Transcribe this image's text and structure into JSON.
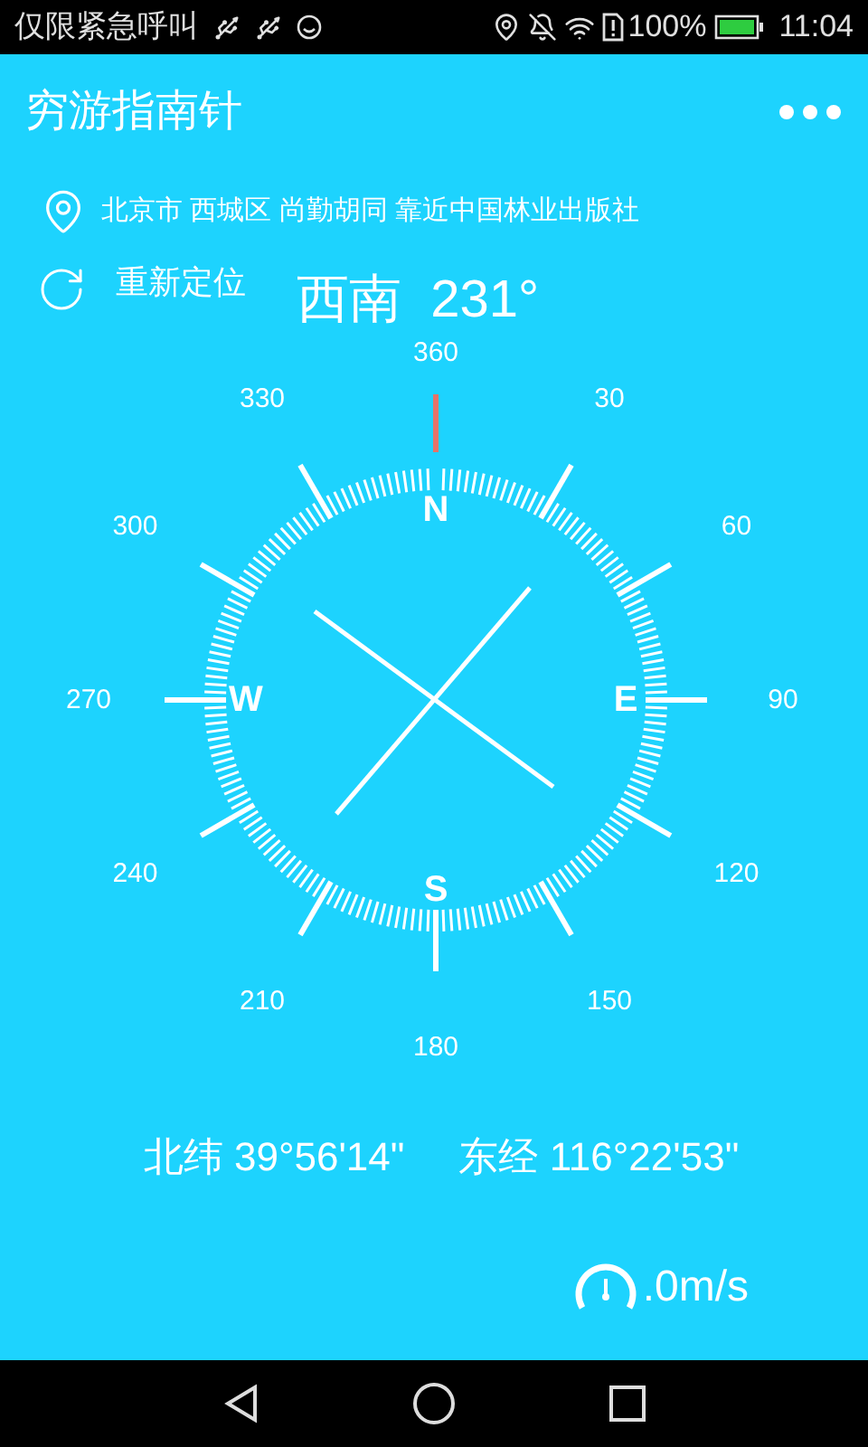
{
  "status_bar": {
    "carrier": "仅限紧急呼叫",
    "battery": "100%",
    "time": "11:04"
  },
  "header": {
    "title": "穷游指南针"
  },
  "location": {
    "address": "北京市 西城区 尚勤胡同 靠近中国林业出版社",
    "relocate_label": "重新定位"
  },
  "heading": {
    "direction": "西南",
    "degrees": "231°"
  },
  "compass": {
    "dial_labels": [
      "360",
      "30",
      "60",
      "90",
      "120",
      "150",
      "180",
      "210",
      "240",
      "270",
      "300",
      "330"
    ],
    "cardinals": [
      "N",
      "E",
      "S",
      "W"
    ]
  },
  "coordinates": {
    "latitude": "北纬 39°56'14\"",
    "longitude": "东经 116°22'53\""
  },
  "speed": {
    "value": ".0m/s"
  }
}
